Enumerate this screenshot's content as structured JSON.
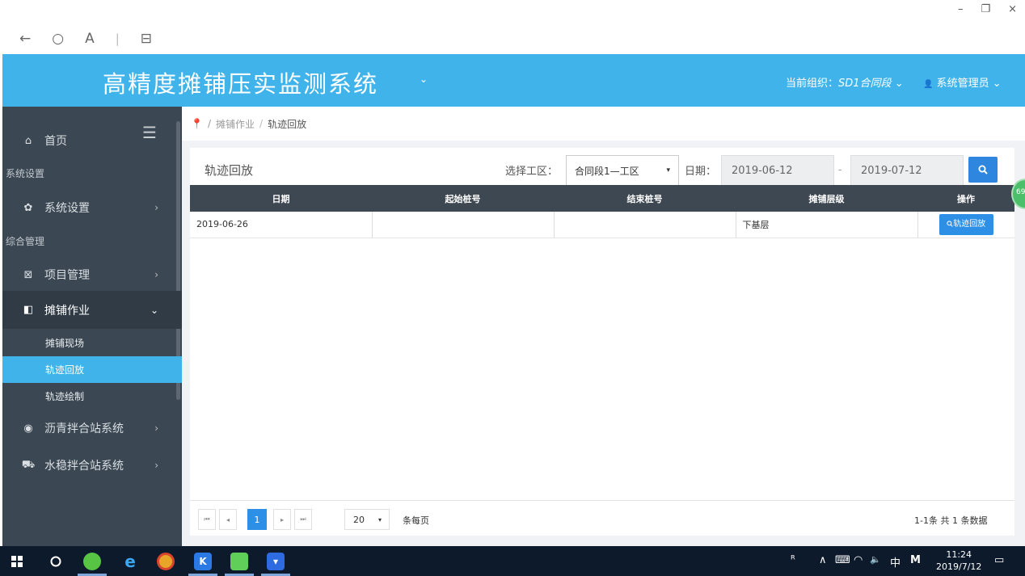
{
  "window": {
    "min": "–",
    "restore": "❐",
    "close": "×"
  },
  "browser": {
    "back": "←",
    "refresh": "○",
    "reader": "A",
    "sep": "|",
    "tabs": "⊟"
  },
  "header": {
    "title": "高精度摊铺压实监测系统",
    "title_chevron": "⌄",
    "org_label": "当前组织：",
    "org_value": "SD1合同段",
    "org_chevron": "⌄",
    "user_icon": "👤",
    "user": "系统管理员",
    "user_chevron": "⌄"
  },
  "sidebar": {
    "hamburger": "☰",
    "home": {
      "icon": "⌂",
      "label": "首页"
    },
    "section_system": "系统设置",
    "system_settings": {
      "icon": "✿",
      "label": "系统设置",
      "chev": "›"
    },
    "section_general": "综合管理",
    "project": {
      "icon": "⊠",
      "label": "项目管理",
      "chev": "›"
    },
    "paving": {
      "icon": "◧",
      "label": "摊铺作业",
      "chev": "⌄"
    },
    "sub_items": [
      "摊铺现场",
      "轨迹回放",
      "轨迹绘制"
    ],
    "asphalt": {
      "icon": "◉",
      "label": "沥青拌合站系统",
      "chev": "›"
    },
    "cement": {
      "icon": "⛟",
      "label": "水稳拌合站系统",
      "chev": "›"
    }
  },
  "breadcrumb": {
    "pin": "📍",
    "slash1": "/",
    "level1": "摊铺作业",
    "slash2": "/",
    "level2": "轨迹回放"
  },
  "panel": {
    "title": "轨迹回放",
    "area_label": "选择工区：",
    "area_value": "合同段1—工区",
    "area_caret": "▾",
    "date_label": "日期：",
    "date_from": "2019-06-12",
    "date_sep": "-",
    "date_to": "2019-07-12"
  },
  "table": {
    "headers": [
      "日期",
      "起始桩号",
      "结束桩号",
      "摊铺层级",
      "操作"
    ],
    "rows": [
      {
        "date": "2019-06-26",
        "start": "",
        "end": "",
        "layer": "下基层",
        "action": "轨迹回放"
      }
    ]
  },
  "pager": {
    "first": "⏮",
    "prev": "◂",
    "current": "1",
    "next": "▸",
    "last": "⏭",
    "page_size": "20",
    "size_caret": "▾",
    "per_page": "条每页",
    "summary": "1-1条  共 1 条数据"
  },
  "badge": "69",
  "taskbar": {
    "tray_person": "ᴿ",
    "tray_chevron": "∧",
    "tray_keyboard": "⌨",
    "tray_wifi": "◠",
    "tray_volume": "🔈",
    "tray_ime": "中",
    "tray_m": "M",
    "time": "11:24",
    "date": "2019/7/12",
    "notify": "▭"
  },
  "colors": {
    "header": "#3fb3ea",
    "sidebar": "#3b4752",
    "accent": "#2e8fe6",
    "taskbar": "#0d1a2b"
  }
}
